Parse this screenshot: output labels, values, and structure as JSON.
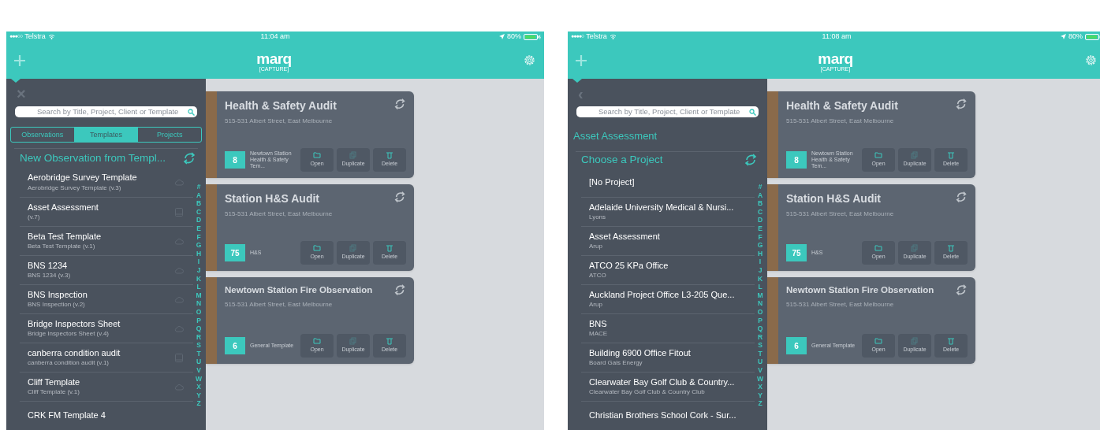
{
  "screens": [
    {
      "status_bar": {
        "signal": "●●●○○",
        "carrier": "Telstra",
        "time": "11:04 am",
        "battery": "80%"
      },
      "header": {
        "logo": "marq",
        "logo_sub": "[CAPTURE]"
      },
      "drawer": {
        "top_button": "×",
        "search": {
          "placeholder": "Search by Title, Project, Client or Template"
        },
        "tabs": [
          {
            "label": "Observations",
            "selected": false
          },
          {
            "label": "Templates",
            "selected": true
          },
          {
            "label": "Projects",
            "selected": false
          }
        ],
        "heading": "New Observation from Templ...",
        "items": [
          {
            "title": "Aerobridge Survey Template",
            "subtitle": "Aerobridge Survey Template (v.3)",
            "kind": "cloud"
          },
          {
            "title": "Asset Assessment",
            "subtitle": "(v.7)",
            "kind": "tablet"
          },
          {
            "title": "Beta Test Template",
            "subtitle": "Beta Test Template (v.1)",
            "kind": "cloud"
          },
          {
            "title": "BNS 1234",
            "subtitle": "BNS 1234 (v.3)",
            "kind": "cloud"
          },
          {
            "title": "BNS Inspection",
            "subtitle": "BNS Inspection (v.2)",
            "kind": "cloud"
          },
          {
            "title": "Bridge Inspectors Sheet",
            "subtitle": "Bridge Inspectors Sheet (v.4)",
            "kind": "cloud"
          },
          {
            "title": "canberra condition audit",
            "subtitle": "canberra condition audit (v.1)",
            "kind": "tablet"
          },
          {
            "title": "Cliff Template",
            "subtitle": "Cliff Template (v.1)",
            "kind": "cloud"
          },
          {
            "title": "CRK FM Template 4"
          }
        ],
        "index": [
          "#",
          "A",
          "B",
          "C",
          "D",
          "E",
          "F",
          "G",
          "H",
          "I",
          "J",
          "K",
          "L",
          "M",
          "N",
          "O",
          "P",
          "Q",
          "R",
          "S",
          "T",
          "U",
          "V",
          "W",
          "X",
          "Y",
          "Z"
        ]
      },
      "cards": [
        {
          "title": "Health & Safety Audit",
          "address": "515-531 Albert Street, East Melbourne",
          "count": "8",
          "template": "Newtown Station Health & Safety Tem...",
          "actions": [
            "Open",
            "Duplicate",
            "Delete"
          ]
        },
        {
          "title": "Station H&S Audit",
          "address": "515-531 Albert Street, East Melbourne",
          "count": "75",
          "template": "H&S",
          "actions": [
            "Open",
            "Duplicate",
            "Delete"
          ]
        },
        {
          "title": "Newtown Station Fire Observation",
          "address": "515-531 Albert Street, East Melbourne",
          "count": "6",
          "template": "General Template",
          "actions": [
            "Open",
            "Duplicate",
            "Delete"
          ]
        }
      ]
    },
    {
      "status_bar": {
        "signal": "●●●●○",
        "carrier": "Telstra",
        "time": "11:08 am",
        "battery": "80%"
      },
      "header": {
        "logo": "marq",
        "logo_sub": "[CAPTURE]"
      },
      "drawer": {
        "top_button": "‹",
        "search": {
          "placeholder": "Search by Title, Project, Client or Template"
        },
        "breadcrumb": "Asset Assessment",
        "heading": "Choose a Project",
        "items": [
          {
            "title": "[No Project]"
          },
          {
            "title": "Adelaide University Medical & Nursi...",
            "subtitle": "Lyons"
          },
          {
            "title": "Asset Assessment",
            "subtitle": "Arup"
          },
          {
            "title": "ATCO 25 KPa Office",
            "subtitle": "ATCO"
          },
          {
            "title": "Auckland Project Office L3-205 Que...",
            "subtitle": "Arup"
          },
          {
            "title": "BNS",
            "subtitle": "MACE"
          },
          {
            "title": "Building 6900 Office Fitout",
            "subtitle": "Board Gais Energy"
          },
          {
            "title": "Clearwater Bay Golf Club & Country...",
            "subtitle": "Clearwater Bay Golf Club & Country Club"
          },
          {
            "title": "Christian Brothers School Cork - Sur..."
          }
        ],
        "index": [
          "#",
          "A",
          "B",
          "C",
          "D",
          "E",
          "F",
          "G",
          "H",
          "I",
          "J",
          "K",
          "L",
          "M",
          "N",
          "O",
          "P",
          "Q",
          "R",
          "S",
          "T",
          "U",
          "V",
          "W",
          "X",
          "Y",
          "Z"
        ]
      },
      "cards": [
        {
          "title": "Health & Safety Audit",
          "address": "515-531 Albert Street, East Melbourne",
          "count": "8",
          "template": "Newtown Station Health & Safety Tem...",
          "actions": [
            "Open",
            "Duplicate",
            "Delete"
          ]
        },
        {
          "title": "Station H&S Audit",
          "address": "515-531 Albert Street, East Melbourne",
          "count": "75",
          "template": "H&S",
          "actions": [
            "Open",
            "Duplicate",
            "Delete"
          ]
        },
        {
          "title": "Newtown Station Fire Observation",
          "address": "515-531 Albert Street, East Melbourne",
          "count": "6",
          "template": "General Template",
          "actions": [
            "Open",
            "Duplicate",
            "Delete"
          ]
        }
      ]
    }
  ]
}
